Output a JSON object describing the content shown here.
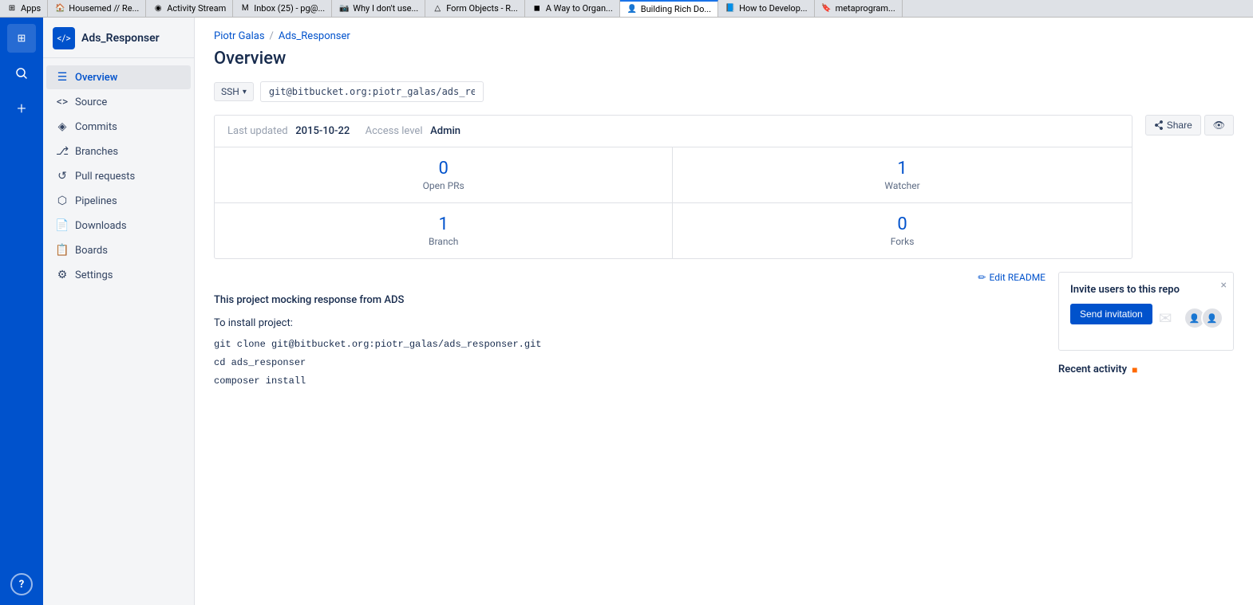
{
  "browser": {
    "tabs": [
      {
        "id": "apps",
        "label": "Apps",
        "favicon": "⊞",
        "active": false
      },
      {
        "id": "housemed",
        "label": "Housemed // Re...",
        "favicon": "🏠",
        "active": false
      },
      {
        "id": "activity-stream",
        "label": "Activity Stream",
        "favicon": "◉",
        "active": false
      },
      {
        "id": "inbox",
        "label": "Inbox (25) - pg@...",
        "favicon": "M",
        "active": false
      },
      {
        "id": "why-i-dont",
        "label": "Why I don't use...",
        "favicon": "📷",
        "active": false
      },
      {
        "id": "form-objects",
        "label": "Form Objects - R...",
        "favicon": "△",
        "active": false
      },
      {
        "id": "a-way-to-organ",
        "label": "A Way to Organ...",
        "favicon": "◼",
        "active": false
      },
      {
        "id": "building-rich",
        "label": "Building Rich Do...",
        "favicon": "👤",
        "active": true
      },
      {
        "id": "how-to-develop",
        "label": "How to Develop...",
        "favicon": "📘",
        "active": false
      },
      {
        "id": "metaprogram",
        "label": "metaprogram...",
        "favicon": "🔖",
        "active": false
      }
    ]
  },
  "iconbar": {
    "apps_label": "⊞",
    "search_label": "🔍",
    "add_label": "+",
    "help_label": "?"
  },
  "sidebar": {
    "repo_name": "Ads_Responser",
    "repo_icon": "</>",
    "nav_items": [
      {
        "id": "overview",
        "label": "Overview",
        "icon": "☰",
        "active": true
      },
      {
        "id": "source",
        "label": "Source",
        "icon": "<>",
        "active": false
      },
      {
        "id": "commits",
        "label": "Commits",
        "icon": "◈",
        "active": false
      },
      {
        "id": "branches",
        "label": "Branches",
        "icon": "⎇",
        "active": false
      },
      {
        "id": "pull-requests",
        "label": "Pull requests",
        "icon": "↺",
        "active": false
      },
      {
        "id": "pipelines",
        "label": "Pipelines",
        "icon": "⬡",
        "active": false
      },
      {
        "id": "downloads",
        "label": "Downloads",
        "icon": "📄",
        "active": false
      },
      {
        "id": "boards",
        "label": "Boards",
        "icon": "📋",
        "active": false
      },
      {
        "id": "settings",
        "label": "Settings",
        "icon": "⚙",
        "active": false
      }
    ]
  },
  "breadcrumb": {
    "user": "Piotr Galas",
    "separator": "/",
    "repo": "Ads_Responser"
  },
  "page": {
    "title": "Overview"
  },
  "clone": {
    "protocol": "SSH",
    "url": "git@bitbucket.org:piotr_galas/ads_respo...",
    "chevron": "▾"
  },
  "repo_stats": {
    "last_updated_label": "Last updated",
    "last_updated_value": "2015-10-22",
    "access_level_label": "Access level",
    "access_level_value": "Admin",
    "open_prs_count": "0",
    "open_prs_label": "Open PRs",
    "watchers_count": "1",
    "watchers_label": "Watcher",
    "branches_count": "1",
    "branches_label": "Branch",
    "forks_count": "0",
    "forks_label": "Forks"
  },
  "share": {
    "share_label": "Share",
    "watch_icon": "👁"
  },
  "invite": {
    "title": "Invite users to this repo",
    "button_label": "Send invitation",
    "close": "×"
  },
  "recent_activity": {
    "title": "Recent activity"
  },
  "readme": {
    "edit_label": "Edit README",
    "project_description": "This project mocking response from ADS",
    "install_label": "To install project:",
    "code_lines": [
      "git clone git@bitbucket.org:piotr_galas/ads_responser.git",
      "cd ads_responser",
      "composer install"
    ]
  }
}
